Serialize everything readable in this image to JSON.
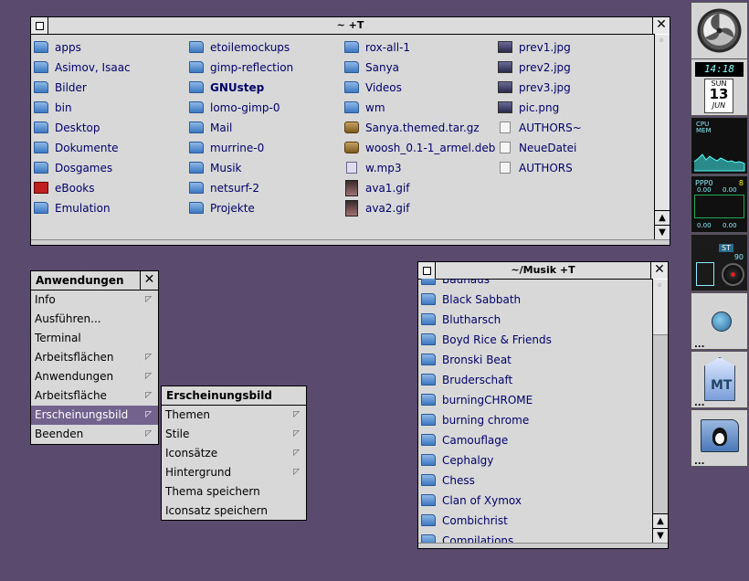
{
  "home_window": {
    "title": "~ +T",
    "columns": [
      [
        {
          "name": "apps",
          "icon": "folder-icon",
          "cls": "folder"
        },
        {
          "name": "Asimov, Isaac",
          "icon": "folder-icon",
          "cls": "folder"
        },
        {
          "name": "Bilder",
          "icon": "folder-icon",
          "cls": "folder"
        },
        {
          "name": "bin",
          "icon": "folder-icon",
          "cls": "folder"
        },
        {
          "name": "Desktop",
          "icon": "folder-icon",
          "cls": "folder"
        },
        {
          "name": "Dokumente",
          "icon": "folder-icon",
          "cls": "folder"
        },
        {
          "name": "Dosgames",
          "icon": "folder-icon",
          "cls": "folder"
        },
        {
          "name": "eBooks",
          "icon": "pdf-folder-icon",
          "cls": "file-pdf"
        },
        {
          "name": "Emulation",
          "icon": "folder-icon",
          "cls": "folder"
        }
      ],
      [
        {
          "name": "etoilemockups",
          "icon": "folder-icon",
          "cls": "folder"
        },
        {
          "name": "gimp-reflection",
          "icon": "folder-icon",
          "cls": "folder"
        },
        {
          "name": "GNUstep",
          "icon": "folder-icon",
          "cls": "folder",
          "bold": true
        },
        {
          "name": "lomo-gimp-0",
          "icon": "folder-icon",
          "cls": "folder"
        },
        {
          "name": "Mail",
          "icon": "folder-icon",
          "cls": "folder"
        },
        {
          "name": "murrine-0",
          "icon": "folder-icon",
          "cls": "folder"
        },
        {
          "name": "Musik",
          "icon": "folder-icon",
          "cls": "folder"
        },
        {
          "name": "netsurf-2",
          "icon": "folder-icon",
          "cls": "folder"
        },
        {
          "name": "Projekte",
          "icon": "folder-icon",
          "cls": "folder"
        }
      ],
      [
        {
          "name": "rox-all-1",
          "icon": "folder-icon",
          "cls": "folder"
        },
        {
          "name": "Sanya",
          "icon": "folder-icon",
          "cls": "folder"
        },
        {
          "name": "Videos",
          "icon": "folder-icon",
          "cls": "folder"
        },
        {
          "name": "wm",
          "icon": "folder-icon",
          "cls": "folder"
        },
        {
          "name": "Sanya.themed.tar.gz",
          "icon": "archive-icon",
          "cls": "file-pkg"
        },
        {
          "name": "woosh_0.1-1_armel.deb",
          "icon": "package-icon",
          "cls": "file-pkg"
        },
        {
          "name": "w.mp3",
          "icon": "audio-file-icon",
          "cls": "file-audio"
        },
        {
          "name": "ava1.gif",
          "icon": "image-file-icon",
          "cls": "file-gif"
        },
        {
          "name": "ava2.gif",
          "icon": "image-file-icon",
          "cls": "file-gif"
        }
      ],
      [
        {
          "name": "prev1.jpg",
          "icon": "image-file-icon",
          "cls": "file-img"
        },
        {
          "name": "prev2.jpg",
          "icon": "image-file-icon",
          "cls": "file-img"
        },
        {
          "name": "prev3.jpg",
          "icon": "image-file-icon",
          "cls": "file-img"
        },
        {
          "name": "pic.png",
          "icon": "image-file-icon",
          "cls": "file-img"
        },
        {
          "name": "AUTHORS~",
          "icon": "text-file-icon",
          "cls": "file-doc"
        },
        {
          "name": "NeueDatei",
          "icon": "text-file-icon",
          "cls": "file-doc"
        },
        {
          "name": "AUTHORS",
          "icon": "text-file-icon",
          "cls": "file-doc"
        }
      ]
    ]
  },
  "musik_window": {
    "title": "~/Musik +T",
    "items": [
      "Bauhaus",
      "Black Sabbath",
      "Blutharsch",
      "Boyd Rice & Friends",
      "Bronski Beat",
      "Bruderschaft",
      "burningCHROME",
      "burning chrome",
      "Camouflage",
      "Cephalgy",
      "Chess",
      "Clan of Xymox",
      "Combichrist",
      "Compilations"
    ]
  },
  "app_menu": {
    "title": "Anwendungen",
    "items": [
      {
        "label": "Info",
        "submenu": true
      },
      {
        "label": "Ausführen...",
        "submenu": false
      },
      {
        "label": "Terminal",
        "submenu": false
      },
      {
        "label": "Arbeitsflächen",
        "submenu": true
      },
      {
        "label": "Anwendungen",
        "submenu": true
      },
      {
        "label": "Arbeitsfläche",
        "submenu": true
      },
      {
        "label": "Erscheinungsbild",
        "submenu": true,
        "selected": true
      },
      {
        "label": "Beenden",
        "submenu": true
      }
    ]
  },
  "sub_menu": {
    "title": "Erscheinungsbild",
    "items": [
      {
        "label": "Themen",
        "submenu": true
      },
      {
        "label": "Stile",
        "submenu": true
      },
      {
        "label": "Iconsätze",
        "submenu": true
      },
      {
        "label": "Hintergrund",
        "submenu": true
      },
      {
        "label": "Thema speichern",
        "submenu": false
      },
      {
        "label": "Iconsatz speichern",
        "submenu": false
      }
    ]
  },
  "dock": {
    "clock_time": "14:18",
    "clock_day": "SUN",
    "clock_date": "13",
    "clock_month": "JUN",
    "cpu_label": "CPU",
    "mem_label": "MEM",
    "net_label": "PPP0",
    "net_values": [
      "0.00",
      "0.00"
    ],
    "net_values2": [
      "0.00",
      "0.00"
    ],
    "mixer_value": "90",
    "mixer_label": "ST",
    "net_flag": "8",
    "net_flag2": "0",
    "dots": "..."
  }
}
